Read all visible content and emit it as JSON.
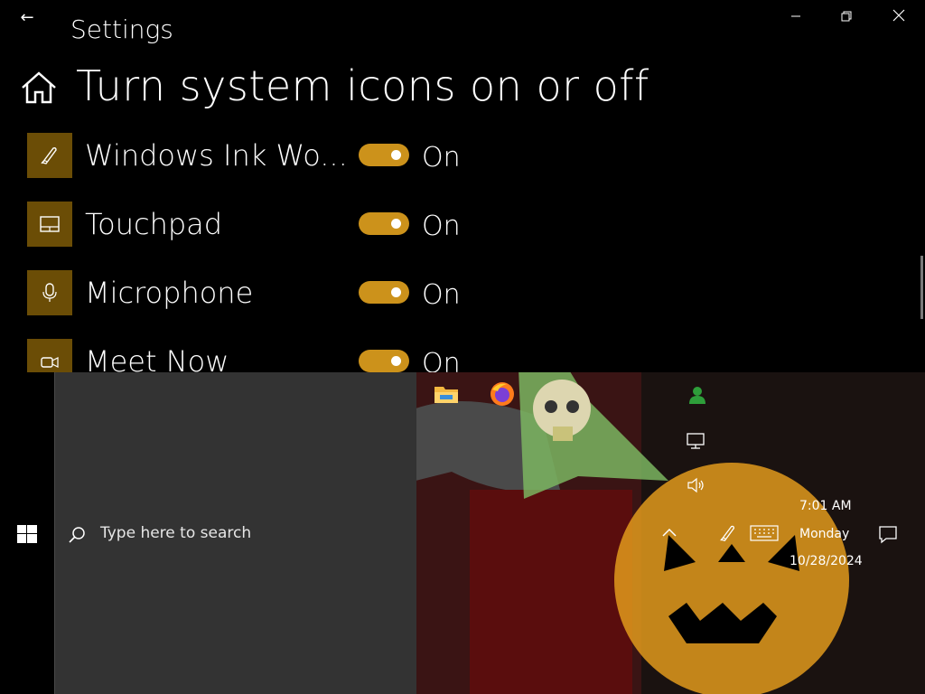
{
  "window": {
    "back_glyph": "←",
    "title": "Settings",
    "minimize_glyph": "—",
    "maximize_glyph": "❐",
    "close_glyph": "✕"
  },
  "page": {
    "title": "Turn system icons on or off",
    "items": [
      {
        "label": "Windows Ink Wo...",
        "state": "On",
        "icon": "pen-icon"
      },
      {
        "label": "Touchpad",
        "state": "On",
        "icon": "touchpad-icon"
      },
      {
        "label": "Microphone",
        "state": "On",
        "icon": "microphone-icon"
      },
      {
        "label": "Meet Now",
        "state": "On",
        "icon": "meet-now-icon"
      }
    ]
  },
  "colors": {
    "accent": "#cc921b",
    "icon_box": "#6b4d06",
    "search_panel": "#333333"
  },
  "taskbar": {
    "search_placeholder": "Type here to search",
    "pinned": [
      "file-explorer-icon",
      "firefox-icon"
    ],
    "tray_icons": [
      "people-icon",
      "network-icon",
      "volume-icon",
      "windows-ink-icon",
      "touch-keyboard-icon"
    ],
    "clock": {
      "time": "7:01 AM",
      "day": "Monday",
      "date": "10/28/2024"
    }
  }
}
